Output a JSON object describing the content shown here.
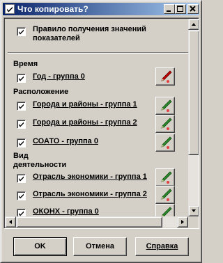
{
  "window": {
    "title": "Что копировать?"
  },
  "titlebar": {
    "icons": [
      "checkbox-app-icon",
      "minimize-icon",
      "maximize-icon",
      "close-icon"
    ]
  },
  "rule": {
    "label_line1": "Правило получения значений",
    "label_line2": "показателей",
    "checked": true
  },
  "sections": {
    "time": "Время",
    "location": "Расположение",
    "activity_line1": "Вид",
    "activity_line2": "деятельности"
  },
  "items": [
    {
      "label": "Год - группа 0",
      "checked": true,
      "pencil_color": "red"
    },
    {
      "label": "Города и районы - группа 1",
      "checked": true,
      "pencil_color": "green"
    },
    {
      "label": "Города и районы - группа 2",
      "checked": true,
      "pencil_color": "green"
    },
    {
      "label": "СОАТО - группа 0",
      "checked": true,
      "pencil_color": "green"
    },
    {
      "label": "Отрасль экономики - группа 1",
      "checked": true,
      "pencil_color": "green"
    },
    {
      "label": "Отрасль экономики - группа 2",
      "checked": true,
      "pencil_color": "green"
    },
    {
      "label": "ОКОНХ - группа 0",
      "checked": true,
      "pencil_color": "green"
    }
  ],
  "buttons": {
    "ok": "OK",
    "cancel": "Отмена",
    "help": "Справка"
  },
  "colors": {
    "title_start": "#0a246a",
    "title_end": "#a6caf0",
    "face": "#d4d0c8",
    "pencil_red": "#c00000",
    "pencil_green": "#2e8b2e"
  }
}
